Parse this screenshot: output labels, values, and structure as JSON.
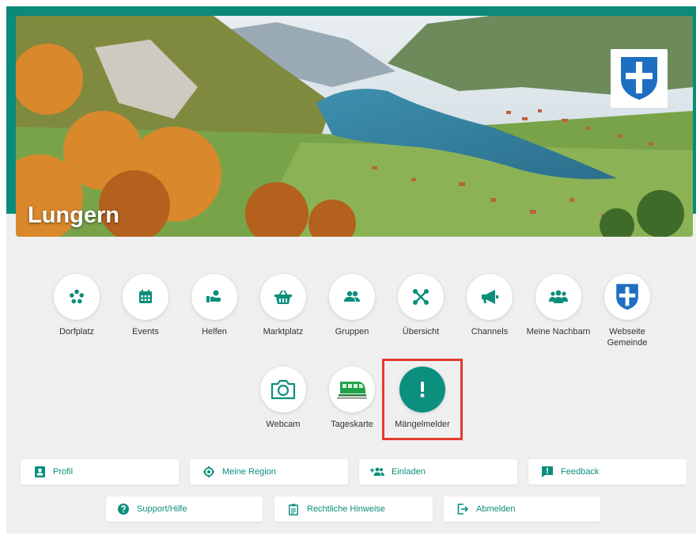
{
  "hero": {
    "title": "Lungern"
  },
  "apps_row1": [
    {
      "label": "Dorfplatz"
    },
    {
      "label": "Events"
    },
    {
      "label": "Helfen"
    },
    {
      "label": "Marktplatz"
    },
    {
      "label": "Gruppen"
    },
    {
      "label": "Übersicht"
    },
    {
      "label": "Channels"
    },
    {
      "label": "Meine Nachbarn"
    },
    {
      "label": "Webseite Gemeinde"
    }
  ],
  "apps_row2": [
    {
      "label": "Webcam"
    },
    {
      "label": "Tageskarte"
    },
    {
      "label": "Mängelmelder"
    }
  ],
  "menu": [
    {
      "label": "Profil"
    },
    {
      "label": "Meine Region"
    },
    {
      "label": "Einladen"
    },
    {
      "label": "Feedback"
    },
    {
      "label": "Support/Hilfe"
    },
    {
      "label": "Rechtliche Hinweise"
    },
    {
      "label": "Abmelden"
    }
  ],
  "colors": {
    "accent": "#0c8f7c",
    "highlight": "#e23b2d",
    "crest": "#1e6fc2"
  }
}
